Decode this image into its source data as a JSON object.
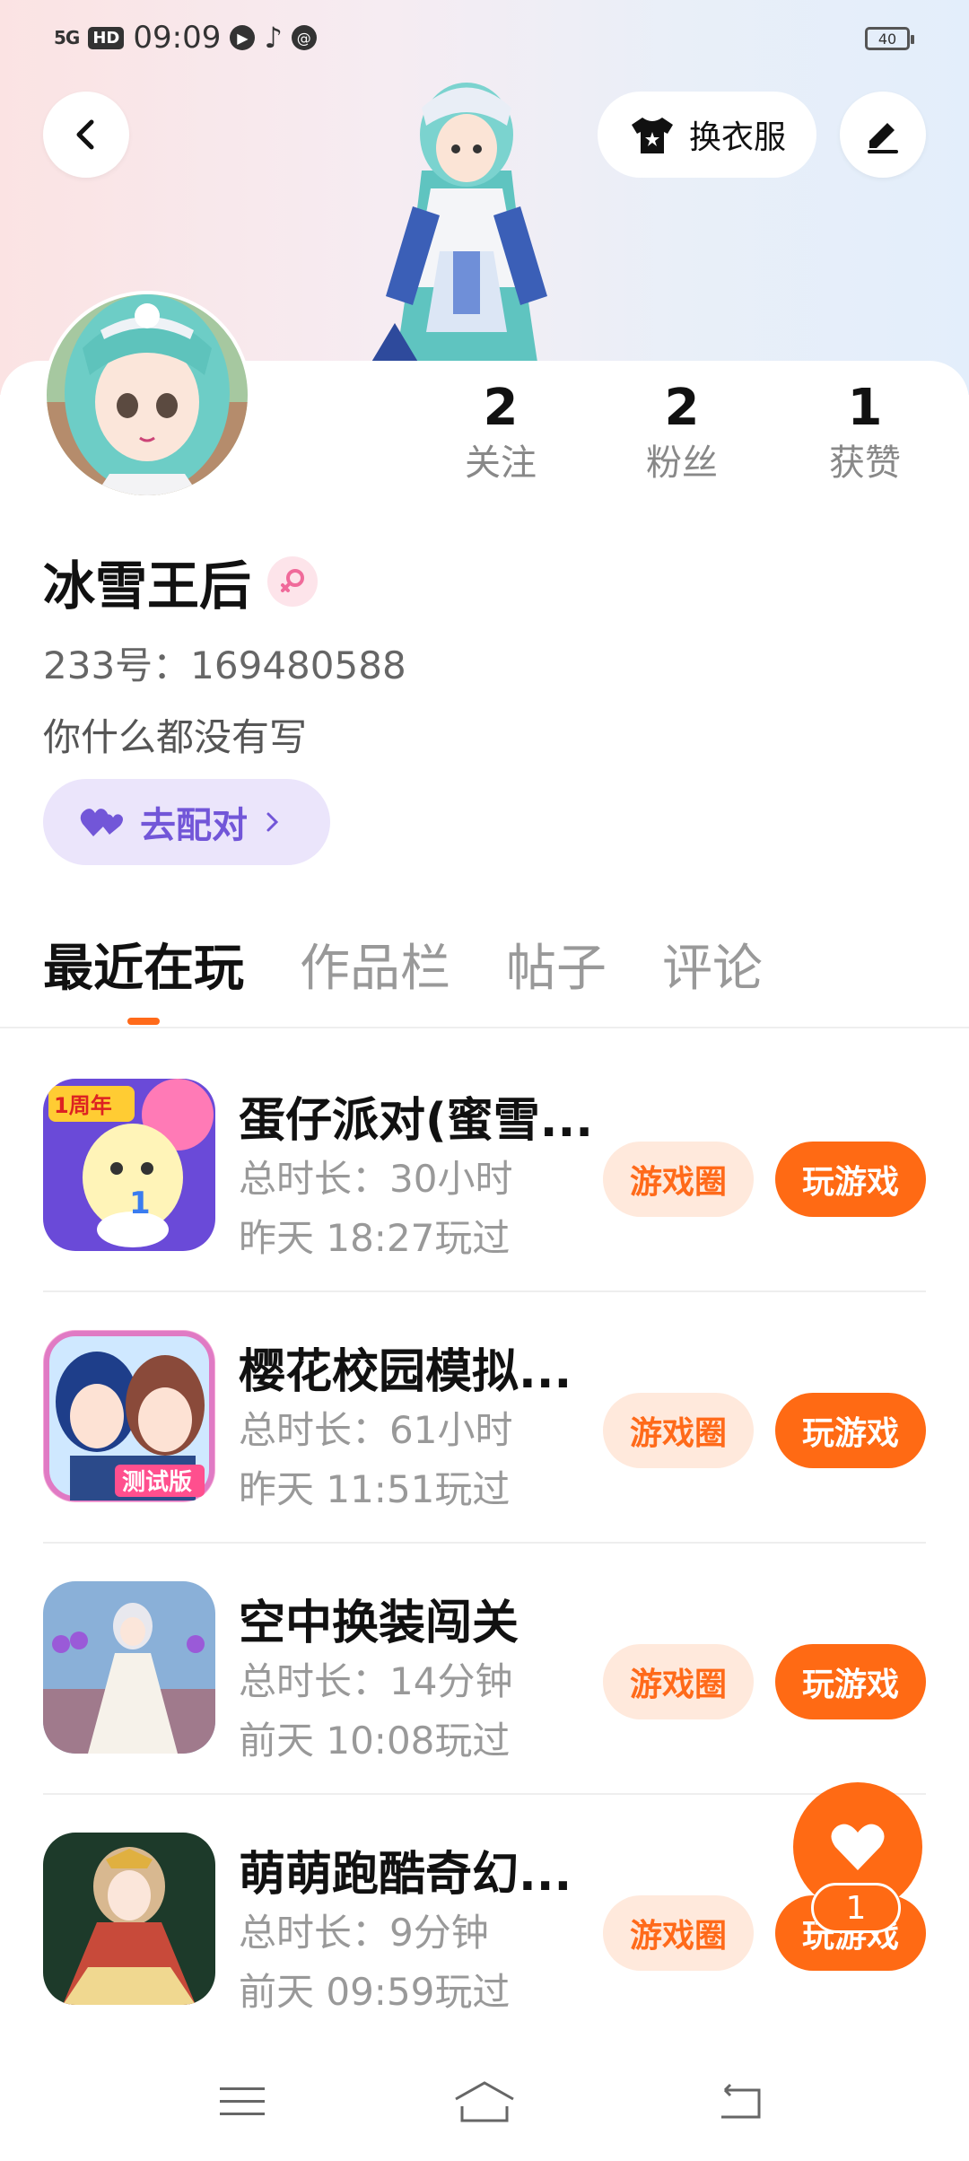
{
  "status_bar": {
    "signal": "5G",
    "hd": "HD",
    "time": "09:09",
    "battery": "40",
    "icons": [
      "signal-icon",
      "hd-icon",
      "music-icon",
      "tiktok-icon",
      "at-icon",
      "battery-icon"
    ]
  },
  "header": {
    "back_icon": "chevron-left-icon",
    "outfit_label": "换衣服",
    "outfit_icon": "shirt-icon",
    "edit_icon": "pencil-icon"
  },
  "stats": [
    {
      "num": "2",
      "label": "关注"
    },
    {
      "num": "2",
      "label": "粉丝"
    },
    {
      "num": "1",
      "label": "获赞"
    }
  ],
  "profile": {
    "name": "冰雪王后",
    "gender_icon": "female-icon",
    "uid": "233号：169480588",
    "bio": "你什么都没有写",
    "pair_label": "去配对",
    "pair_icon": "hearts-icon"
  },
  "tabs": [
    "最近在玩",
    "作品栏",
    "帖子",
    "评论"
  ],
  "games": [
    {
      "title": "蛋仔派对(蜜雪...",
      "duration": "总时长：30小时",
      "last": "昨天 18:27玩过",
      "circle": "游戏圈",
      "play": "玩游戏",
      "badge": "1周年"
    },
    {
      "title": "樱花校园模拟...",
      "duration": "总时长：61小时",
      "last": "昨天 11:51玩过",
      "circle": "游戏圈",
      "play": "玩游戏",
      "badge": "测试版"
    },
    {
      "title": "空中换装闯关",
      "duration": "总时长：14分钟",
      "last": "前天 10:08玩过",
      "circle": "游戏圈",
      "play": "玩游戏"
    },
    {
      "title": "萌萌跑酷奇幻...",
      "duration": "总时长：9分钟",
      "last": "前天 09:59玩过",
      "circle": "游戏圈",
      "play": "玩游戏"
    }
  ],
  "floating": {
    "count": "1",
    "icon": "heart-icon"
  },
  "nav": {
    "icons": [
      "menu-icon",
      "home-icon",
      "back-icon"
    ]
  },
  "colors": {
    "accent": "#ff6a14",
    "pair": "#7256d8"
  }
}
